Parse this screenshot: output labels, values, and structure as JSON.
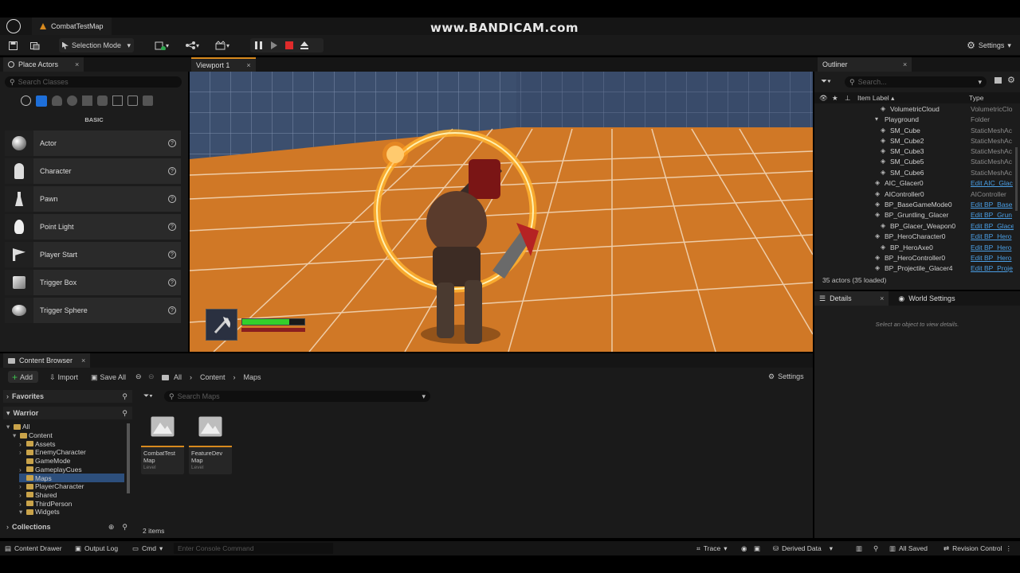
{
  "watermark": "www.BANDICAM.com",
  "document_tab": "CombatTestMap",
  "toolbar": {
    "selection_mode": "Selection Mode",
    "settings": "Settings"
  },
  "place_actors": {
    "tab": "Place Actors",
    "search_placeholder": "Search Classes",
    "category": "BASIC",
    "items": [
      "Actor",
      "Character",
      "Pawn",
      "Point Light",
      "Player Start",
      "Trigger Box",
      "Trigger Sphere"
    ]
  },
  "viewport": {
    "tab": "Viewport 1"
  },
  "outliner": {
    "tab": "Outliner",
    "search_placeholder": "Search...",
    "col_label": "Item Label",
    "col_type": "Type",
    "rows": [
      {
        "name": "VolumetricCloud",
        "type": "VolumetricClo",
        "link": false
      },
      {
        "name": "Playground",
        "type": "Folder",
        "link": false
      },
      {
        "name": "SM_Cube",
        "type": "StaticMeshAc",
        "link": false
      },
      {
        "name": "SM_Cube2",
        "type": "StaticMeshAc",
        "link": false
      },
      {
        "name": "SM_Cube3",
        "type": "StaticMeshAc",
        "link": false
      },
      {
        "name": "SM_Cube5",
        "type": "StaticMeshAc",
        "link": false
      },
      {
        "name": "SM_Cube6",
        "type": "StaticMeshAc",
        "link": false
      },
      {
        "name": "AIC_Glacer0",
        "type": "Edit AIC_Glac",
        "link": true
      },
      {
        "name": "AIController0",
        "type": "AIController",
        "link": false
      },
      {
        "name": "BP_BaseGameMode0",
        "type": "Edit BP_Base",
        "link": true
      },
      {
        "name": "BP_Gruntling_Glacer",
        "type": "Edit BP_Grun",
        "link": true
      },
      {
        "name": "BP_Glacer_Weapon0",
        "type": "Edit BP_Glace",
        "link": true
      },
      {
        "name": "BP_HeroCharacter0",
        "type": "Edit BP_Hero",
        "link": true
      },
      {
        "name": "BP_HeroAxe0",
        "type": "Edit BP_Hero",
        "link": true
      },
      {
        "name": "BP_HeroController0",
        "type": "Edit BP_Hero",
        "link": true
      },
      {
        "name": "BP_Projectile_Glacer4",
        "type": "Edit BP_Proje",
        "link": true
      }
    ],
    "count": "35 actors (35 loaded)"
  },
  "details": {
    "tab": "Details",
    "world_tab": "World Settings",
    "empty": "Select an object to view details."
  },
  "content_browser": {
    "tab": "Content Browser",
    "add": "Add",
    "import": "Import",
    "save_all": "Save All",
    "crumbs": [
      "All",
      "Content",
      "Maps"
    ],
    "settings": "Settings",
    "favorites": "Favorites",
    "project": "Warrior",
    "search_placeholder": "Search Maps",
    "tree": [
      {
        "label": "All",
        "depth": 0
      },
      {
        "label": "Content",
        "depth": 1
      },
      {
        "label": "Assets",
        "depth": 2
      },
      {
        "label": "EnemyCharacter",
        "depth": 2
      },
      {
        "label": "GameMode",
        "depth": 2
      },
      {
        "label": "GameplayCues",
        "depth": 2
      },
      {
        "label": "Maps",
        "depth": 2
      },
      {
        "label": "PlayerCharacter",
        "depth": 2
      },
      {
        "label": "Shared",
        "depth": 2
      },
      {
        "label": "ThirdPerson",
        "depth": 2
      },
      {
        "label": "Widgets",
        "depth": 2
      }
    ],
    "assets": [
      {
        "name": "CombatTest Map",
        "kind": "Level"
      },
      {
        "name": "FeatureDev Map",
        "kind": "Level"
      }
    ],
    "collections": "Collections",
    "item_count": "2 items"
  },
  "statusbar": {
    "content_drawer": "Content Drawer",
    "output_log": "Output Log",
    "cmd": "Cmd",
    "console_placeholder": "Enter Console Command",
    "trace": "Trace",
    "derived_data": "Derived Data",
    "all_saved": "All Saved",
    "revision_control": "Revision Control"
  },
  "hud": {
    "health_fraction": 0.75
  }
}
